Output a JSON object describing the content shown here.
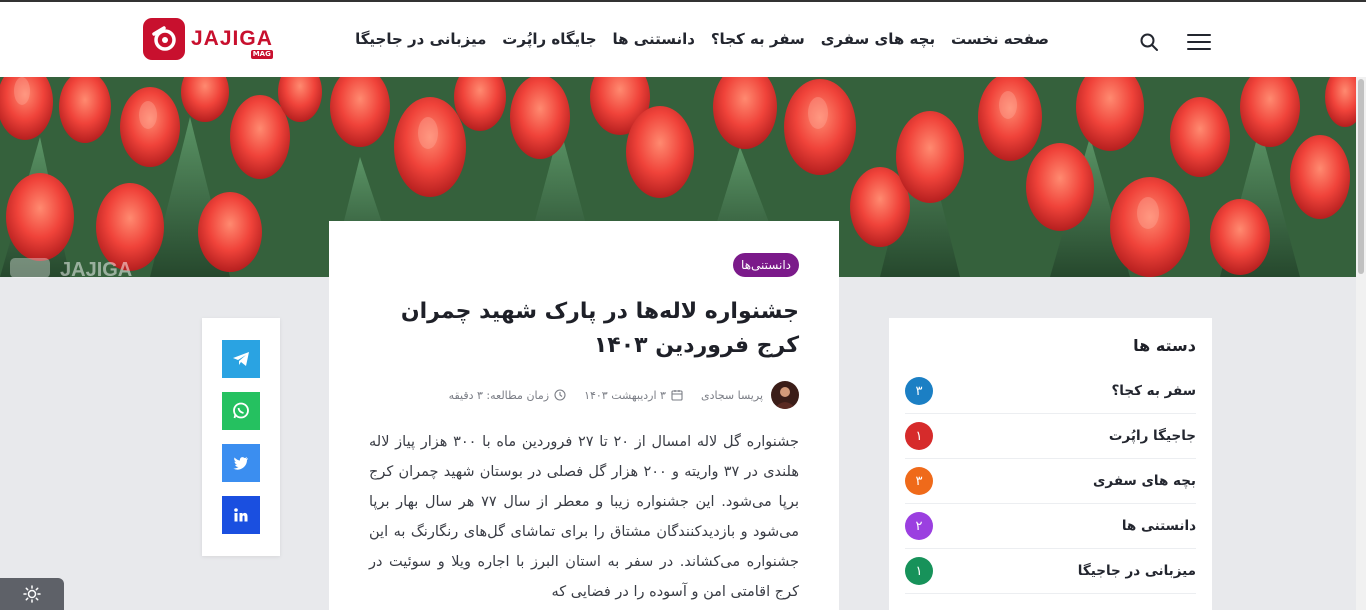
{
  "header": {
    "logo_text": "JAJIGA",
    "logo_sub": "MAG",
    "nav": [
      "صفحه نخست",
      "بچه های سفری",
      "سفر به کجا؟",
      "دانستنی ها",
      "جایگاه راپُرت",
      "میزبانی در جاجیگا"
    ]
  },
  "hero": {
    "watermark": "JAJIGA"
  },
  "article": {
    "category": "دانستنی‌ها",
    "title": "جشنواره لاله‌ها در پارک شهید چمران کرج فروردین ۱۴۰۳",
    "author": "پریسا سجادی",
    "date": "۳ اردیبهشت ۱۴۰۳",
    "reading_time": "زمان مطالعه: ۳ دقیقه",
    "body": "جشنواره گل لاله امسال از ۲۰ تا ۲۷ فروردین ماه با ۳۰۰ هزار پیاز لاله هلندی در ۳۷ واریته و ۲۰۰ هزار گل فصلی در بوستان شهید چمران کرج برپا می‌شود. این جشنواره زیبا و معطر از سال ۷۷ هر سال بهار برپا می‌شود و بازدیدکنندگان مشتاق را برای تماشای گل‌های رنگارنگ به این جشنواره می‌کشاند. در سفر به استان البرز با اجاره ویلا و سوئیت در کرج اقامتی امن و آسوده را در فضایی که"
  },
  "categories": {
    "title": "دسته ها",
    "items": [
      {
        "name": "سفر به کجا؟",
        "count": "۳",
        "color": "#1b7fc4"
      },
      {
        "name": "جاجیگا راپُرت",
        "count": "۱",
        "color": "#d62b2b"
      },
      {
        "name": "بچه های سفری",
        "count": "۳",
        "color": "#ef6a1a"
      },
      {
        "name": "دانستنی ها",
        "count": "۲",
        "color": "#9b3fe0"
      },
      {
        "name": "میزبانی در جاجیگا",
        "count": "۱",
        "color": "#17925a"
      }
    ]
  },
  "share": {
    "buttons": [
      {
        "name": "telegram",
        "color": "#2aa3e2"
      },
      {
        "name": "whatsapp",
        "color": "#25c160"
      },
      {
        "name": "twitter",
        "color": "#3b8ef0"
      },
      {
        "name": "linkedin",
        "color": "#1a4fe0"
      }
    ]
  },
  "colors": {
    "brand": "#c8102e",
    "badge": "#7b1a8a"
  }
}
